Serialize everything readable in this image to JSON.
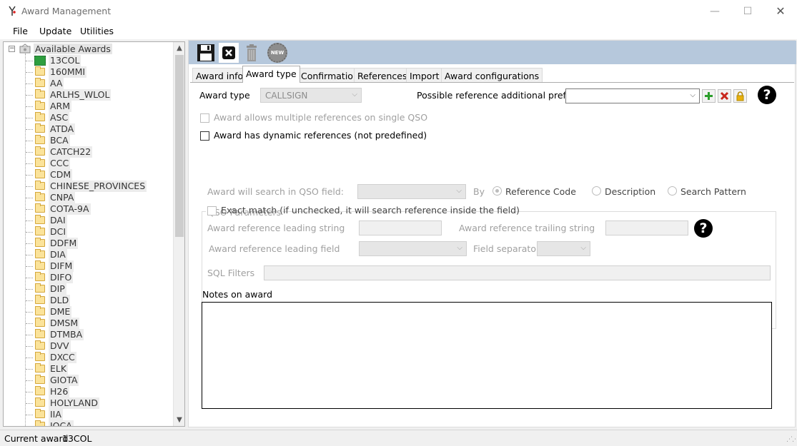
{
  "window": {
    "title": "Award Management",
    "minimize": "—",
    "maximize": "☐",
    "close": "✕"
  },
  "menu": {
    "file": "File",
    "update": "Update",
    "utilities": "Utilities"
  },
  "tree": {
    "root_label": "Available Awards",
    "root_toggle": "−",
    "selected": "13COL",
    "items": [
      "13COL",
      "160MMI",
      "AA",
      "ARLHS_WLOL",
      "ARM",
      "ASC",
      "ATDA",
      "BCA",
      "CATCH22",
      "CCC",
      "CDM",
      "CHINESE_PROVINCES",
      "CNPA",
      "COTA-9A",
      "DAI",
      "DCI",
      "DDFM",
      "DIA",
      "DIFM",
      "DIFO",
      "DIP",
      "DLD",
      "DME",
      "DMSM",
      "DTMBA",
      "DVV",
      "DXCC",
      "ELK",
      "GIOTA",
      "H26",
      "HOLYLAND",
      "IIA",
      "IOCA"
    ],
    "scroll_up": "▲",
    "scroll_down": "▼"
  },
  "toolbar": {
    "new_badge": "NEW"
  },
  "tabs": [
    "Award info",
    "Award type",
    "Confirmation",
    "References",
    "Import",
    "Award configurations"
  ],
  "active_tab": "Award type",
  "form": {
    "award_type_label": "Award type",
    "award_type_value": "CALLSIGN",
    "prefixes_label": "Possible reference additional prefixes",
    "prefixes_value": "",
    "multi_ref_label": "Award allows multiple references on single QSO",
    "dynamic_ref_label": "Award has dynamic references (not predefined)",
    "help": "?",
    "arrow": "⌵"
  },
  "qso": {
    "group_title": "QSO Parameters",
    "search_field_label": "Award will search in QSO field:",
    "by_label": "By",
    "radio_reference_code": "Reference Code",
    "radio_description": "Description",
    "radio_search_pattern": "Search Pattern",
    "exact_match_label": "Exact match (if unchecked, it will search reference inside the field)",
    "leading_string_label": "Award reference leading string",
    "trailing_string_label": "Award reference trailing string",
    "leading_field_label": "Award reference leading field",
    "field_separator_label": "Field separator",
    "sql_filters_label": "SQL Filters"
  },
  "notes": {
    "label": "Notes on award"
  },
  "status": {
    "label": "Current award",
    "value": "13COL",
    "grip": "⋰⋰"
  },
  "colors": {
    "toolbar_bg": "#b6c8dc",
    "selected_node": "#2e9e3f",
    "disabled_text": "#a0a0a0"
  }
}
